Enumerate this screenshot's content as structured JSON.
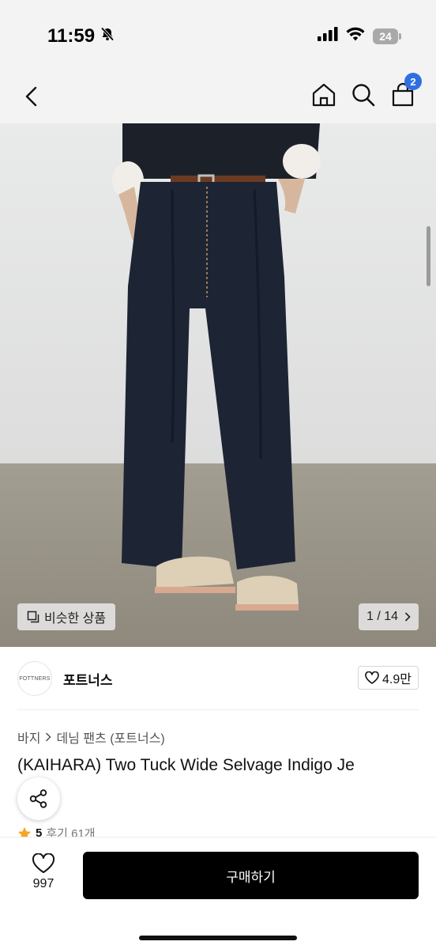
{
  "status_bar": {
    "time": "11:59",
    "battery": "24"
  },
  "header": {
    "cart_count": "2"
  },
  "gallery": {
    "similar_label": "비슷한 상품",
    "counter": "1 / 14"
  },
  "brand": {
    "logo_text": "FOTTNERS",
    "name": "포트너스",
    "likes": "4.9만"
  },
  "breadcrumb": {
    "category": "바지",
    "subcategory": "데님 팬츠 (포트너스)"
  },
  "product": {
    "title": "(KAIHARA) Two Tuck Wide Selvage Indigo Je",
    "rating": "5",
    "reviews": "후기 61개"
  },
  "bottom_bar": {
    "wish_count": "997",
    "buy_label": "구매하기"
  },
  "colors": {
    "accent": "#2f6fe0",
    "rating_star": "#f5a623",
    "buy_button": "#000000"
  },
  "icons": [
    "bell-slash-icon",
    "signal-icon",
    "wifi-icon",
    "battery-icon",
    "back-icon",
    "home-icon",
    "search-icon",
    "cart-icon",
    "copy-icon",
    "chevron-right-icon",
    "heart-icon",
    "share-icon",
    "star-icon"
  ]
}
